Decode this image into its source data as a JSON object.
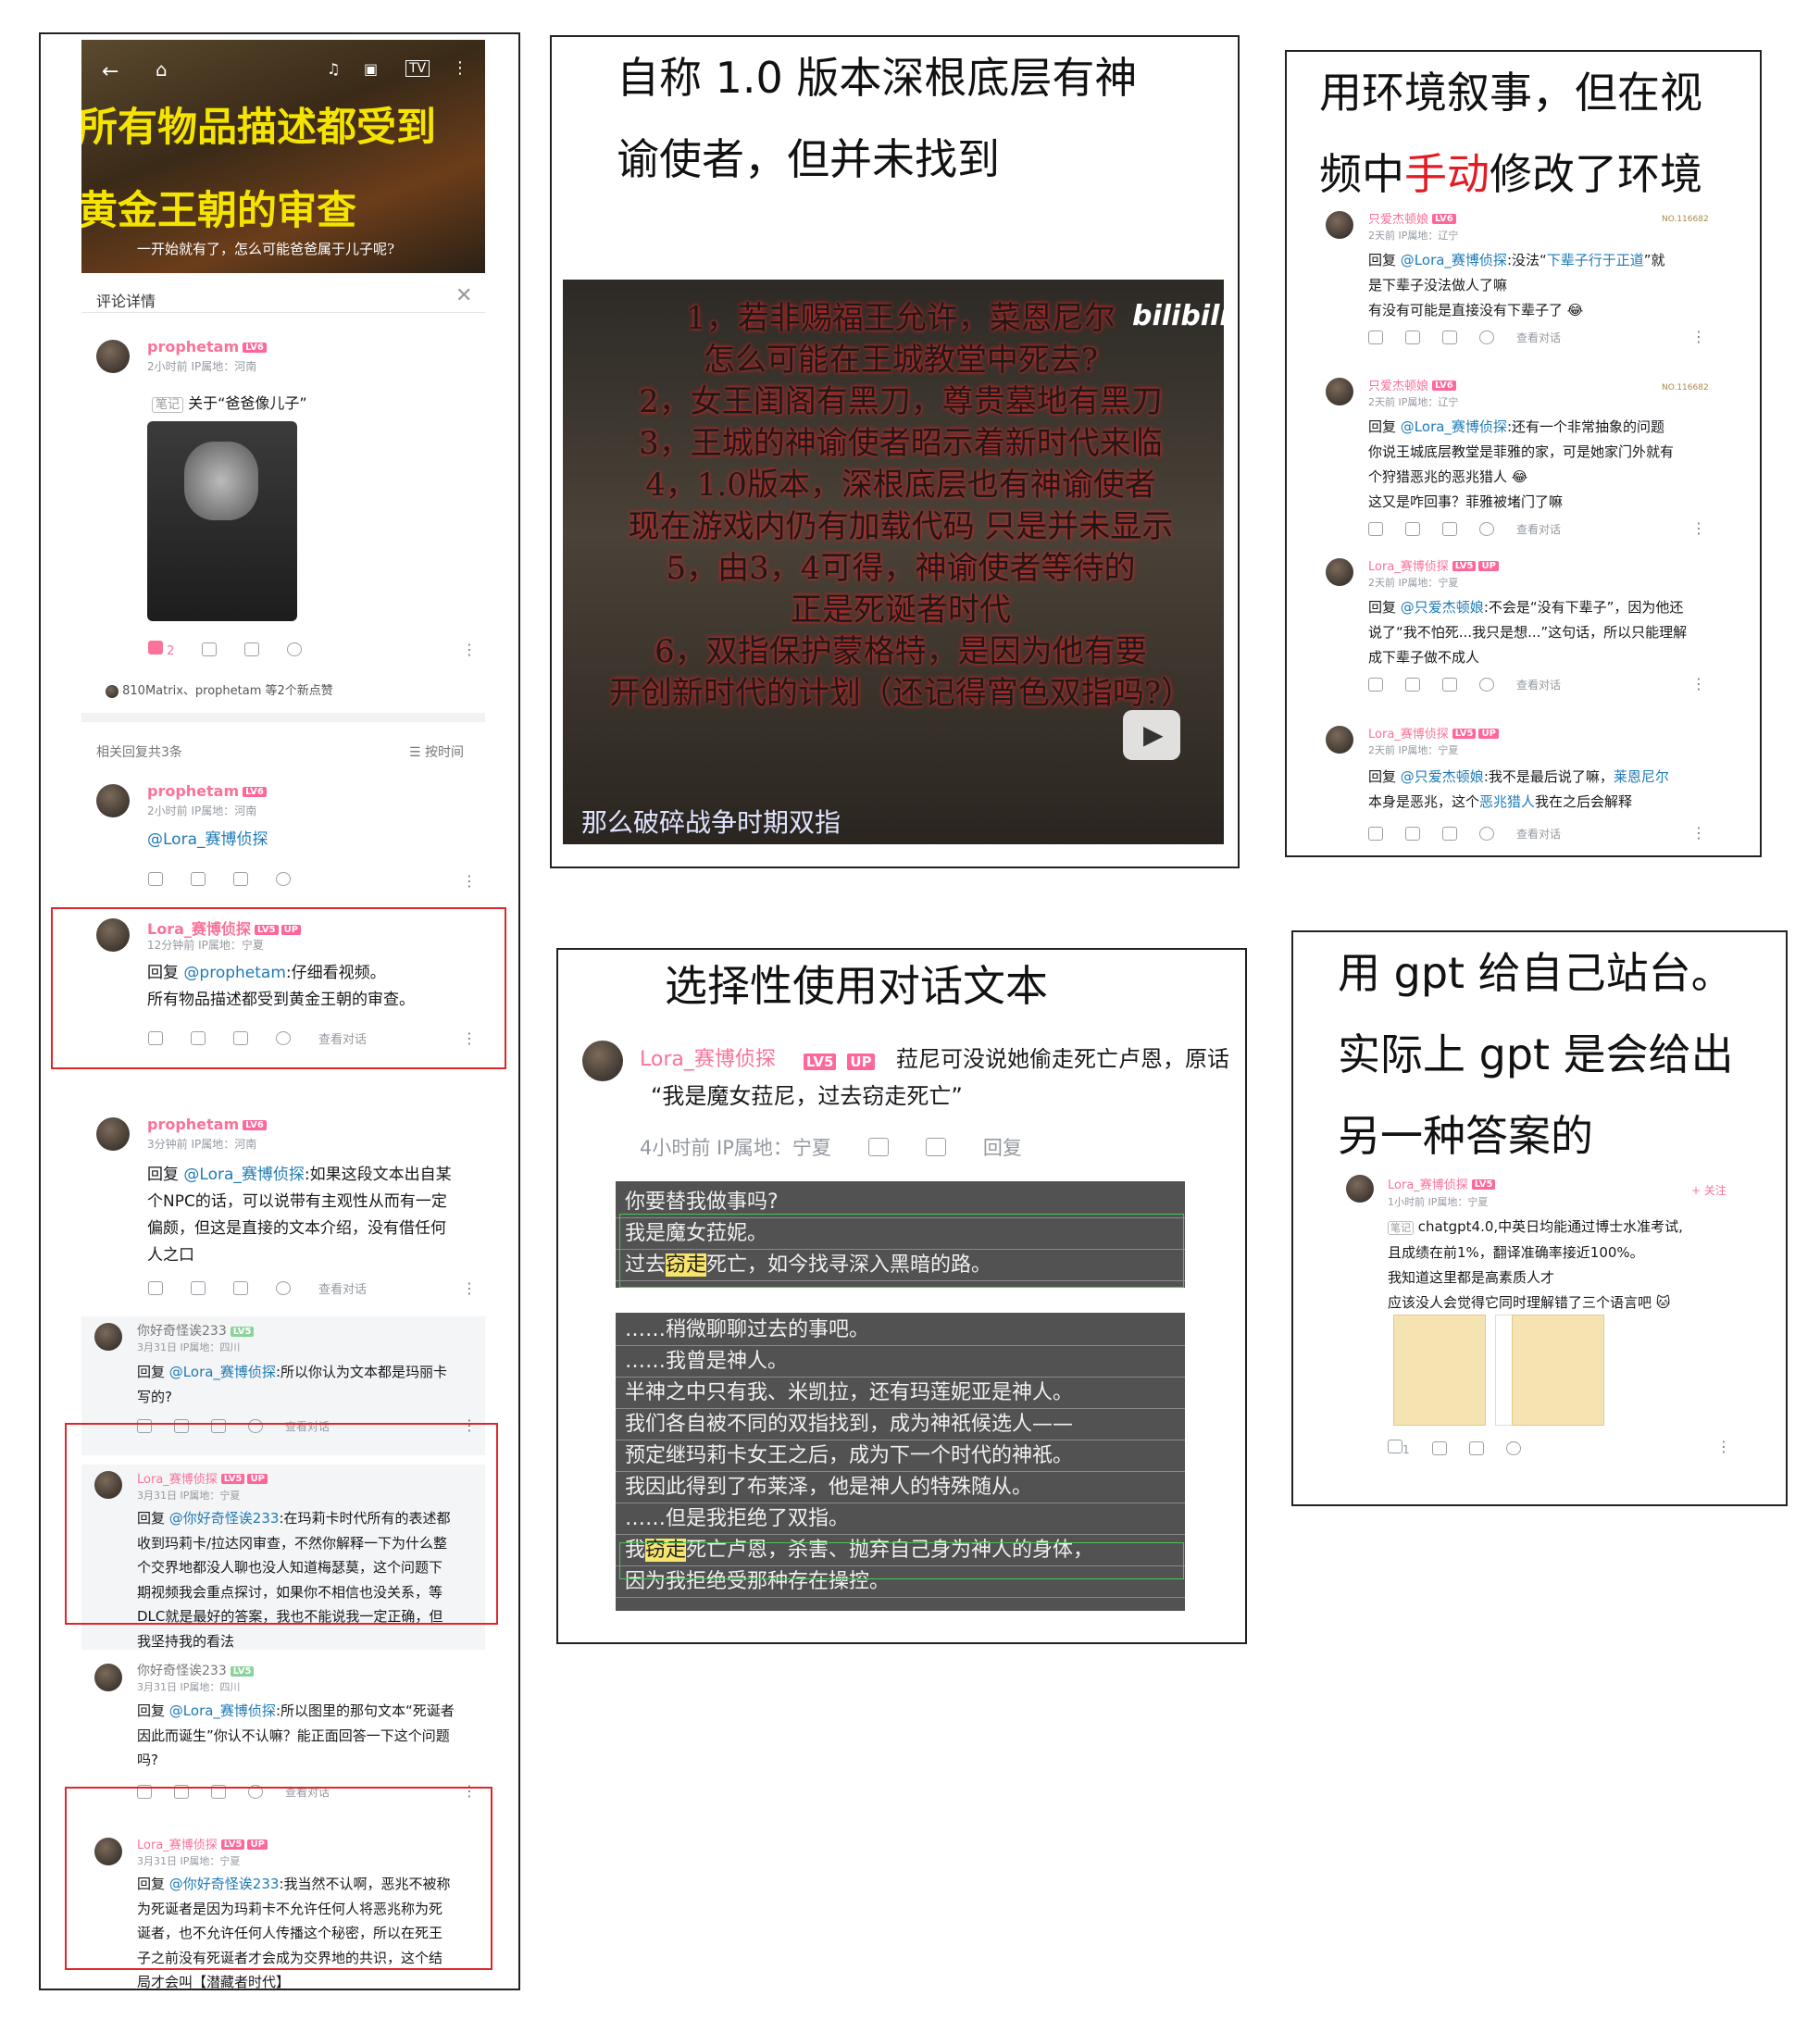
{
  "left": {
    "banner_line1": "所有物品描述都受到",
    "banner_line2": "黄金王朝的审查",
    "banner_caption": "一开始就有了，怎么可能爸爸属于儿子呢?",
    "detail_title": "评论详情",
    "c1": {
      "user": "prophetam",
      "lv": "LV6",
      "meta": "2小时前 IP属地：河南",
      "note_tag": "笔记",
      "note_text": "关于“爸爸像儿子”",
      "likes": "2"
    },
    "likes_line": "810Matrix、prophetam 等2个新点赞",
    "related": "相关回复共3条",
    "sort": "按时间",
    "r1": {
      "user": "prophetam",
      "lv": "LV6",
      "meta": "2小时前 IP属地：河南",
      "text": "@Lora_赛博侦探"
    },
    "r2": {
      "user": "Lora_赛博侦探",
      "lv": "LV5",
      "up": "UP",
      "meta": "12分钟前 IP属地：宁夏",
      "prefix": "回复",
      "at": "@prophetam",
      "text": ":仔细看视频。",
      "text2": "所有物品描述都受到黄金王朝的审查。",
      "view": "查看对话"
    },
    "r3": {
      "user": "prophetam",
      "lv": "LV6",
      "meta": "3分钟前 IP属地：河南",
      "prefix": "回复",
      "at": "@Lora_赛博侦探",
      "l1": ":如果这段文本出自某",
      "l2": "个NPC的话，可以说带有主观性从而有一定",
      "l3": "偏颇，但这是直接的文本介绍，没有借任何",
      "l4": "人之口",
      "view": "查看对话"
    },
    "r4": {
      "user": "你好奇怪诶233",
      "lv": "LV5",
      "meta": "3月31日 IP属地：四川",
      "prefix": "回复",
      "at": "@Lora_赛博侦探",
      "l1": ":所以你认为文本都是玛丽卡",
      "l2": "写的?",
      "view": "查看对话"
    },
    "r5": {
      "user": "Lora_赛博侦探",
      "lv": "LV5",
      "up": "UP",
      "meta": "3月31日 IP属地：宁夏",
      "prefix": "回复",
      "at": "@你好奇怪诶233",
      "l1": ":在玛莉卡时代所有的表述都",
      "l2": "收到玛莉卡/拉达冈审查，不然你解释一下为什么整",
      "l3": "个交界地都没人聊也没人知道梅瑟莫，这个问题下",
      "l4": "期视频我会重点探讨，如果你不相信也没关系，等",
      "l5": "DLC就是最好的答案，我也不能说我一定正确，但",
      "l6": "我坚持我的看法"
    },
    "r6": {
      "user": "你好奇怪诶233",
      "lv": "LV5",
      "meta": "3月31日 IP属地：四川",
      "prefix": "回复",
      "at": "@Lora_赛博侦探",
      "l1": ":所以图里的那句文本“死诞者",
      "l2": "因此而诞生”你认不认嘛？能正面回答一下这个问题",
      "l3": "吗?",
      "view": "查看对话"
    },
    "r7": {
      "user": "Lora_赛博侦探",
      "lv": "LV5",
      "up": "UP",
      "meta": "3月31日 IP属地：宁夏",
      "prefix": "回复",
      "at": "@你好奇怪诶233",
      "l1": ":我当然不认啊，恶兆不被称",
      "l2": "为死诞者是因为玛莉卡不允许任何人将恶兆称为死",
      "l3": "诞者，也不允许任何人传播这个秘密，所以在死王",
      "l4": "子之前没有死诞者才会成为交界地的共识，这个结",
      "l5": "局才会叫【潜藏者时代】"
    }
  },
  "mid_top": {
    "title1": "自称 1.0 版本深根底层有神",
    "title2": "谕使者，但并未找到",
    "lines": [
      "1，若非赐福王允许，菜恩尼尔",
      "怎么可能在王城教堂中死去?",
      "2，女王闺阁有黑刀，尊贵墓地有黑刀",
      "3，王城的神谕使者昭示着新时代来临",
      "4，1.0版本，深根底层也有神谕使者",
      "现在游戏内仍有加载代码 只是并未显示",
      "5，由3，4可得，神谕使者等待的",
      "正是死诞者时代",
      "6，双指保护蒙格特，是因为他有要",
      "开创新时代的计划（还记得宵色双指吗?）"
    ],
    "watermark": "bilibili",
    "subtitle": "那么破碎战争时期双指"
  },
  "mid_bottom": {
    "title": "选择性使用对话文本",
    "user": "Lora_赛博侦探",
    "lv": "LV5",
    "up": "UP",
    "comment1": "菈尼可没说她偷走死亡卢恩，原话",
    "comment2": "“我是魔女菈尼，过去窃走死亡”",
    "meta": "4小时前 IP属地：宁夏",
    "reply": "回复",
    "d1": [
      "你要替我做事吗?",
      "我是魔女菈妮。",
      "过去窃走死亡，如今找寻深入黑暗的路。"
    ],
    "d2": [
      "……稍微聊聊过去的事吧。",
      "……我曾是神人。",
      "半神之中只有我、米凯拉，还有玛莲妮亚是神人。",
      "我们各自被不同的双指找到，成为神祇候选人——",
      "预定继玛莉卡女王之后，成为下一个时代的神祇。",
      "我因此得到了布莱泽，他是神人的特殊随从。",
      "……但是我拒绝了双指。",
      "我窃走死亡卢恩，杀害、抛弃自己身为神人的身体，",
      "因为我拒绝受那种存在操控。"
    ]
  },
  "right_top": {
    "title1": "用环境叙事，但在视",
    "title2a": "频中",
    "title2b": "手动",
    "title2c": "修改了环境",
    "c1": {
      "user": "只爱杰顿娘",
      "lv": "LV6",
      "meta": "2天前 IP属地：辽宁",
      "prefix": "回复",
      "at": "@Lora_赛博侦探",
      "l1": ":没法“",
      "link": "下辈子行于正道",
      "l1b": "”就",
      "l2": "是下辈子没法做人了嘛",
      "l3": "有没有可能是直接没有下辈子了",
      "view": "查看对话",
      "badge": "NO.116682"
    },
    "c2": {
      "user": "只爱杰顿娘",
      "lv": "LV6",
      "meta": "2天前 IP属地：辽宁",
      "prefix": "回复",
      "at": "@Lora_赛博侦探",
      "l1": ":还有一个非常抽象的问题",
      "l2": "你说王城底层教堂是菲雅的家，可是她家门外就有",
      "l3": "个狩猎恶兆的恶兆猎人",
      "l4": "这又是咋回事？菲雅被堵门了嘛",
      "view": "查看对话",
      "badge": "NO.116682"
    },
    "c3": {
      "user": "Lora_赛博侦探",
      "lv": "LV5",
      "up": "UP",
      "meta": "2天前 IP属地：宁夏",
      "prefix": "回复",
      "at": "@只爱杰顿娘",
      "l1": ":不会是“没有下辈子”，因为他还",
      "l2": "说了“我不怕死...我只是想...”这句话，所以只能理解",
      "l3": "成下辈子做不成人",
      "view": "查看对话"
    },
    "c4": {
      "user": "Lora_赛博侦探",
      "lv": "LV5",
      "up": "UP",
      "meta": "2天前 IP属地：宁夏",
      "prefix": "回复",
      "at": "@只爱杰顿娘",
      "l1": ":我不是最后说了嘛，",
      "link1": "莱恩尼尔",
      "l2a": "本身是恶兆，这个",
      "link2": "恶兆猎人",
      "l2b": "我在之后会解释",
      "view": "查看对话"
    }
  },
  "right_bottom": {
    "title1": "用 gpt 给自己站台。",
    "title2": "实际上 gpt 是会给出",
    "title3": "另一种答案的",
    "user": "Lora_赛博侦探",
    "lv": "LV5",
    "follow": "+ 关注",
    "meta": "1小时前 IP属地：宁夏",
    "note_tag": "笔记",
    "l1": "chatgpt4.0,中英日均能通过博士水准考试,",
    "l2": "且成绩在前1%，翻译准确率接近100%。",
    "l3": "我知道这里都是高素质人才",
    "l4": "应该没人会觉得它同时理解错了三个语言吧",
    "likes": "1"
  },
  "colors": {
    "accent": "#fb7299",
    "link": "#1e7ab5",
    "red_box": "#e0262a",
    "banner_text": "#f5e400"
  }
}
